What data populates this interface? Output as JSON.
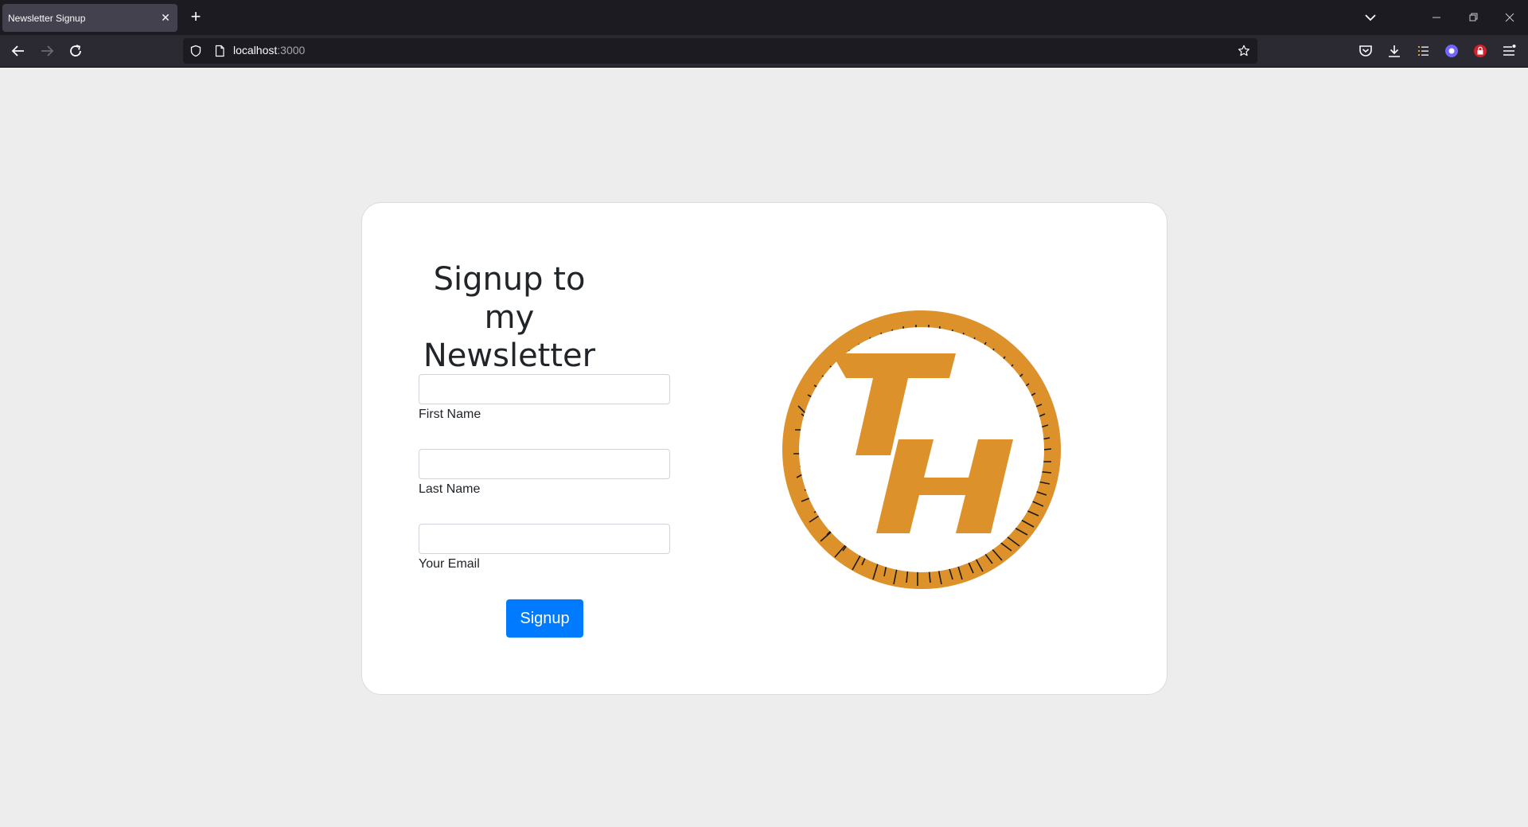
{
  "browser": {
    "tab_title": "Newsletter Signup",
    "url_host": "localhost",
    "url_port": ":3000"
  },
  "colors": {
    "page_background": "#ededed",
    "card_background": "#ffffff",
    "accent_button": "#007bff",
    "logo_orange": "#dd912b"
  },
  "form": {
    "heading_line1": "Signup to my",
    "heading_line2": "Newsletter",
    "first_name_label": "First Name",
    "last_name_label": "Last Name",
    "email_label": "Your Email",
    "first_name_value": "",
    "last_name_value": "",
    "email_value": "",
    "submit_label": "Signup"
  },
  "logo": {
    "name": "TH-circuit-logo"
  }
}
